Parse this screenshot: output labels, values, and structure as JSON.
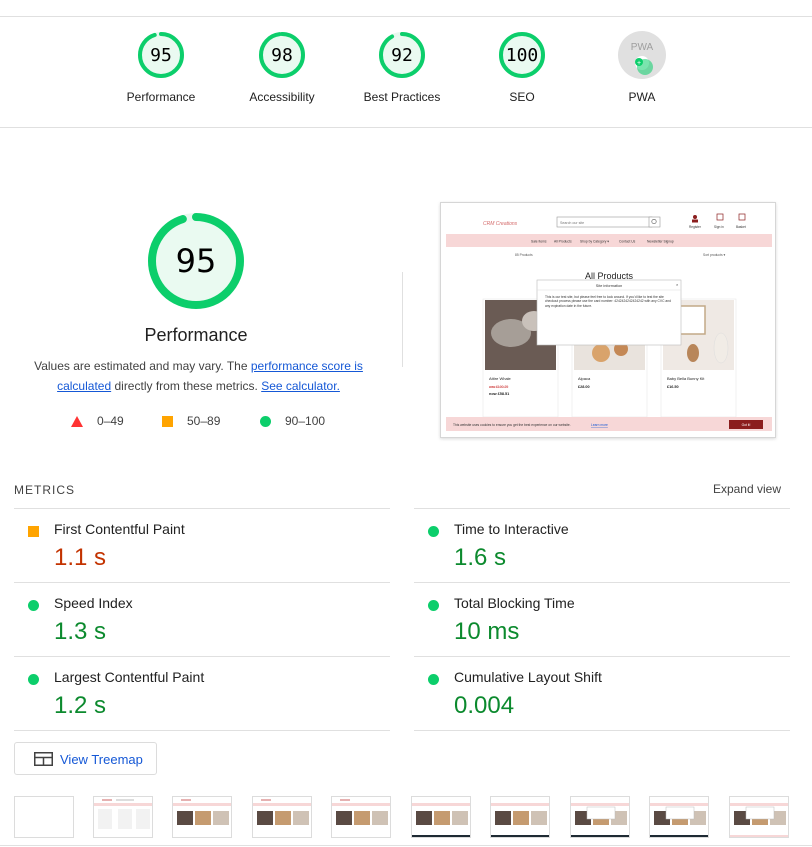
{
  "colors": {
    "pass": "#0cce6b",
    "pass_text": "#0c8a2e",
    "average": "#ffa400",
    "fail": "#ff3333",
    "orange_text": "#c33300",
    "link": "#1558d6"
  },
  "categories": [
    {
      "label": "Performance",
      "score": "95",
      "fraction": 0.95
    },
    {
      "label": "Accessibility",
      "score": "98",
      "fraction": 0.98
    },
    {
      "label": "Best Practices",
      "score": "92",
      "fraction": 0.92
    },
    {
      "label": "SEO",
      "score": "100",
      "fraction": 1.0
    },
    {
      "label": "PWA",
      "badge_text": "PWA"
    }
  ],
  "performance": {
    "score": "95",
    "fraction": 0.95,
    "title": "Performance",
    "desc_prefix": "Values are estimated and may vary. The ",
    "desc_link": "performance score is calculated",
    "desc_middle": " directly from these metrics. ",
    "desc_calc_link": "See calculator."
  },
  "legend": [
    {
      "range": "0–49",
      "icon": "fail-triangle-icon"
    },
    {
      "range": "50–89",
      "icon": "average-square-icon"
    },
    {
      "range": "90–100",
      "icon": "pass-circle-icon"
    }
  ],
  "screenshot": {
    "logo": "CRM Creations",
    "search_placeholder": "Search our site",
    "icons": [
      "Register",
      "Sign in",
      "Basket"
    ],
    "nav": [
      "Sale Items",
      "All Products",
      "Shop by Category ▾",
      "Contact Us",
      "Newsletter Signup"
    ],
    "count": "85 Products",
    "sort": "Sort products ▾",
    "heading": "All Products",
    "modal_title": "Site information",
    "modal_text": "This is our test site, but please feel free to look around. If you'd like to test the site checkout process please use the card number: 4242424242424242 with any CVC and any expiration date in the future.",
    "products": [
      {
        "name": "Attire Whale",
        "old_price": "was £100.29",
        "price": "now £58.51"
      },
      {
        "name": "Alpaca",
        "price": "£28.00"
      },
      {
        "name": "Baby Bella Bunny Kit",
        "price": "£16.50"
      }
    ],
    "cookie_text": "This website uses cookies to ensure you get the best experience on our website.",
    "cookie_link": "Learn more",
    "cookie_btn": "Got it!"
  },
  "metrics": {
    "heading": "METRICS",
    "expand": "Expand view",
    "items": [
      {
        "name": "First Contentful Paint",
        "value": "1.1 s",
        "rating": "average"
      },
      {
        "name": "Time to Interactive",
        "value": "1.6 s",
        "rating": "pass"
      },
      {
        "name": "Speed Index",
        "value": "1.3 s",
        "rating": "pass"
      },
      {
        "name": "Total Blocking Time",
        "value": "10 ms",
        "rating": "pass"
      },
      {
        "name": "Largest Contentful Paint",
        "value": "1.2 s",
        "rating": "pass"
      },
      {
        "name": "Cumulative Layout Shift",
        "value": "0.004",
        "rating": "pass"
      }
    ]
  },
  "treemap": {
    "label": "View Treemap"
  }
}
